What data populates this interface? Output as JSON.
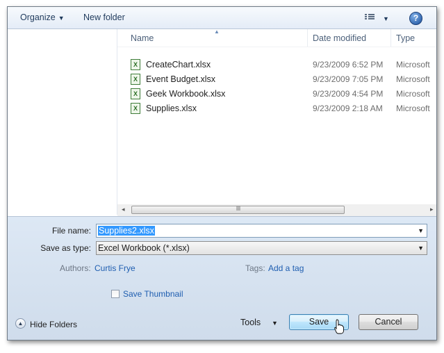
{
  "toolbar": {
    "organize_label": "Organize",
    "new_folder_label": "New folder",
    "view_icon": "view-details-icon",
    "help_label": "?"
  },
  "columns": {
    "name": "Name",
    "date_modified": "Date modified",
    "type": "Type"
  },
  "files": [
    {
      "name": "CreateChart.xlsx",
      "date": "9/23/2009 6:52 PM",
      "type": "Microsoft"
    },
    {
      "name": "Event Budget.xlsx",
      "date": "9/23/2009 7:05 PM",
      "type": "Microsoft"
    },
    {
      "name": "Geek Workbook.xlsx",
      "date": "9/23/2009 4:54 PM",
      "type": "Microsoft"
    },
    {
      "name": "Supplies.xlsx",
      "date": "9/23/2009 2:18 AM",
      "type": "Microsoft"
    }
  ],
  "file_icon_text": "X",
  "scrollbar": {
    "left_arrow": "◂",
    "right_arrow": "▸",
    "grip": "lll"
  },
  "form": {
    "file_name_label": "File name:",
    "file_name_value": "Supplies2.xlsx",
    "save_as_type_label": "Save as type:",
    "save_as_type_value": "Excel Workbook (*.xlsx)",
    "authors_label": "Authors:",
    "authors_value": "Curtis Frye",
    "tags_label": "Tags:",
    "tags_value": "Add a tag",
    "save_thumbnail_label": "Save Thumbnail",
    "save_thumbnail_checked": false
  },
  "footer": {
    "hide_folders_label": "Hide Folders",
    "tools_label": "Tools",
    "save_label": "Save",
    "cancel_label": "Cancel"
  },
  "colors": {
    "accent_link": "#1f5eb0",
    "selection": "#3399ff",
    "bottom_panel": "#d6e2f0"
  }
}
